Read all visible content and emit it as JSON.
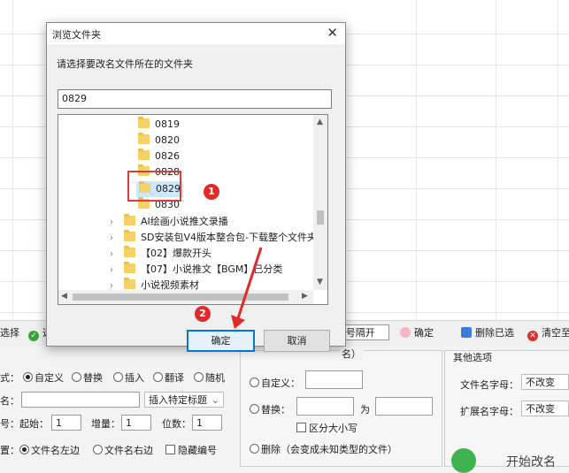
{
  "dialog": {
    "title": "浏览文件夹",
    "close_glyph": "✕",
    "prompt": "请选择要改名文件所在的文件夹",
    "path_value": "0829",
    "tree": {
      "folders": [
        "0819",
        "0820",
        "0826",
        "0828",
        "0829",
        "0830"
      ],
      "selected": "0829",
      "parent_folders": [
        "AI绘画小说推文录播",
        "SD安装包V4版本整合包-下载整个文件夹",
        "【02】爆款开头",
        "【07】小说推文【BGM】已分类",
        "小说视频素材"
      ]
    },
    "ok_label": "确定",
    "cancel_label": "取消"
  },
  "annotations": {
    "step1": "1",
    "step2": "2",
    "accent": "#e23a3a"
  },
  "toolbar": {
    "select_label": "选择",
    "item2_label": "选",
    "separator_placeholder": "|号隔开",
    "confirm_label": "确定",
    "delete_selected_label": "删除已选",
    "clear_label": "清空至"
  },
  "options": {
    "mode_label": "式：",
    "modes": [
      "自定义",
      "替换",
      "插入",
      "翻译",
      "随机"
    ],
    "name_label": "名：",
    "insert_label": "插入特定标题",
    "start_label": "起始：",
    "start_value": "1",
    "increment_label": "增量：",
    "increment_value": "1",
    "digits_label": "位数：",
    "digits_value": "1",
    "num_prefix": "号：",
    "pos_prefix": "置：",
    "pos_left": "文件名左边",
    "pos_right": "文件名右边",
    "hide_number": "隐藏编号",
    "ext_group_title": "名）",
    "ext_custom": "自定义：",
    "ext_replace": "替换：",
    "ext_to": "为",
    "ext_case": "区分大小写",
    "ext_delete": "删除（会变成未知类型的文件）",
    "other_title": "其他选项",
    "filename_case_label": "文件名字母：",
    "filename_case_value": "不改变",
    "ext_case_label": "扩展名字母：",
    "ext_case_value": "不改变",
    "start_rename": "开始改名"
  },
  "colors": {
    "primary_border": "#0078d7",
    "folder": "#f5d16a"
  }
}
